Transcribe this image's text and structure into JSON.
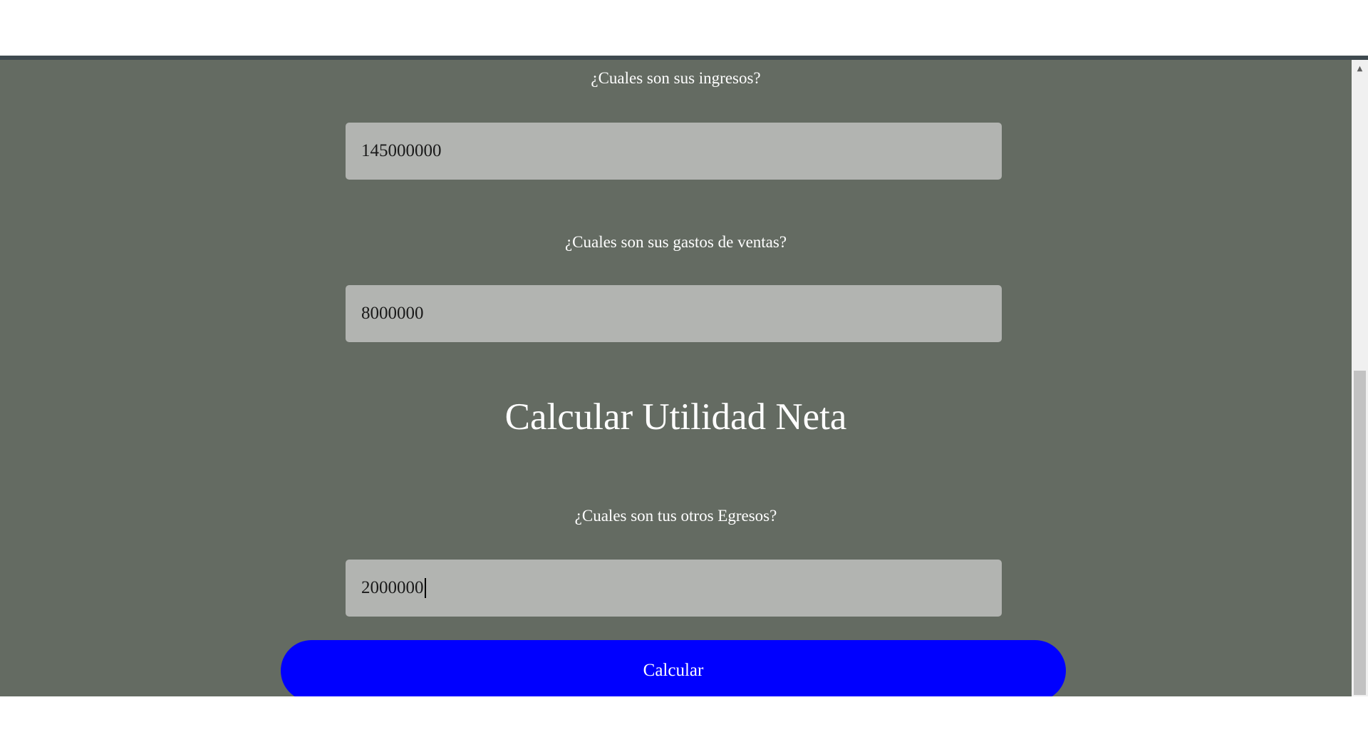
{
  "form": {
    "ingresos": {
      "label": "¿Cuales son sus ingresos?",
      "value": "145000000"
    },
    "gastos_ventas": {
      "label": "¿Cuales son sus gastos de ventas?",
      "value": "8000000"
    },
    "section_heading": "Calcular Utilidad Neta",
    "otros_egresos": {
      "label": "¿Cuales son tus otros Egresos?",
      "value": "2000000"
    },
    "submit_label": "Calcular"
  },
  "colors": {
    "page_background": "#646b62",
    "field_background": "#b2b4b1",
    "button_background": "#0000ff",
    "text_light": "#ffffff"
  },
  "icons": {
    "scroll_up": "arrow-up-icon"
  }
}
